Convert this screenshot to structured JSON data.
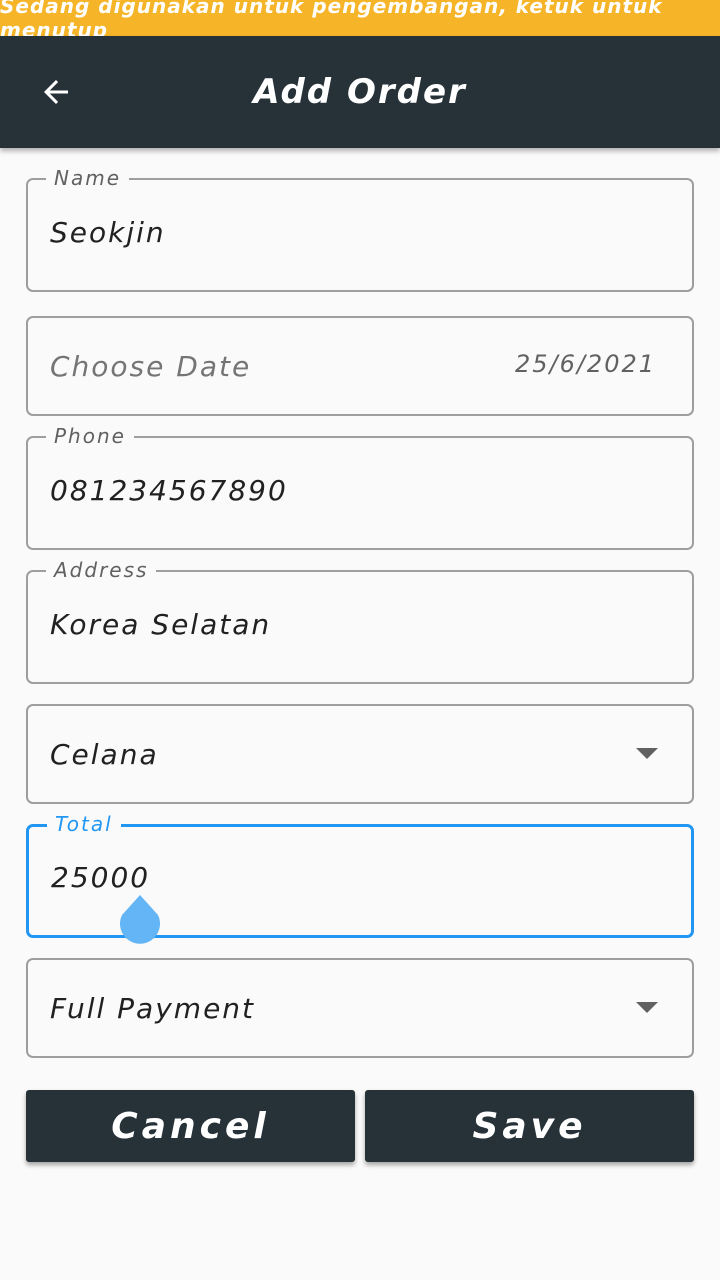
{
  "dev_banner": {
    "text": "Sedang digunakan untuk pengembangan, ketuk untuk menutup"
  },
  "app_bar": {
    "title": "Add Order",
    "back_icon": "arrow-left-icon"
  },
  "form": {
    "name": {
      "label": "Name",
      "value": "Seokjin"
    },
    "date": {
      "placeholder": "Choose Date",
      "value": "25/6/2021"
    },
    "phone": {
      "label": "Phone",
      "value": "081234567890"
    },
    "address": {
      "label": "Address",
      "value": "Korea Selatan"
    },
    "product": {
      "selected": "Celana",
      "icon": "dropdown-arrow-icon"
    },
    "total": {
      "label": "Total",
      "value": "25000"
    },
    "payment": {
      "selected": "Full Payment",
      "icon": "dropdown-arrow-icon"
    }
  },
  "buttons": {
    "cancel_label": "Cancel",
    "save_label": "Save"
  },
  "colors": {
    "banner": "#f6b428",
    "app_bar": "#263238",
    "focus": "#2196f3",
    "cursor_handle": "#64b5f6"
  }
}
